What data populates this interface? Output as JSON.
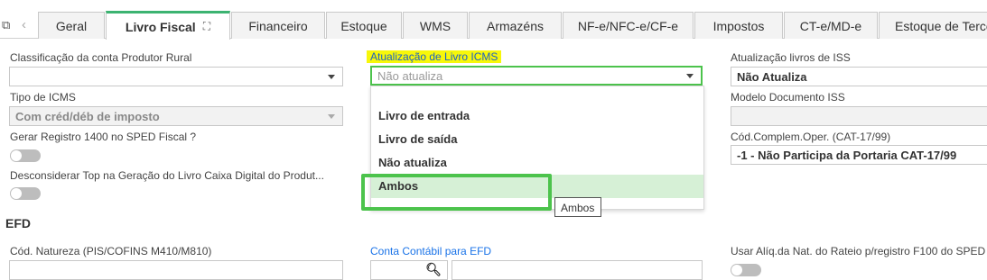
{
  "tabs": [
    {
      "label": "Geral"
    },
    {
      "label": "Livro Fiscal",
      "icon": "⛶"
    },
    {
      "label": "Financeiro"
    },
    {
      "label": "Estoque"
    },
    {
      "label": "WMS"
    },
    {
      "label": "Armazéns"
    },
    {
      "label": "NF-e/NFC-e/CF-e"
    },
    {
      "label": "Impostos"
    },
    {
      "label": "CT-e/MD-e"
    },
    {
      "label": "Estoque de Terce"
    }
  ],
  "left": {
    "classificacao_label": "Classificação da conta Produtor Rural",
    "classificacao_value": "",
    "tipo_icms_label": "Tipo de ICMS",
    "tipo_icms_value": "Com créd/déb de imposto",
    "registro1400_label": "Gerar Registro 1400 no SPED Fiscal ?",
    "desconsiderar_label": "Desconsiderar Top na Geração do Livro Caixa Digital do Produt..."
  },
  "middle": {
    "atualizacao_label": "Atualização de Livro ICMS",
    "atualizacao_placeholder": "Não atualiza",
    "options": [
      "Livro de entrada",
      "Livro de saída",
      "Não atualiza",
      "Ambos"
    ],
    "tooltip": "Ambos"
  },
  "right": {
    "iss_label": "Atualização livros de ISS",
    "iss_value": "Não Atualiza",
    "modelo_label": "Modelo Documento ISS",
    "modelo_value": "",
    "cod_label": "Cód.Complem.Oper. (CAT-17/99)",
    "cod_value": "-1 - Não Participa da Portaria CAT-17/99"
  },
  "efd": {
    "section_title": "EFD",
    "natureza_label": "Cód. Natureza (PIS/COFINS M410/M810)",
    "conta_label": "Conta Contábil para EFD",
    "aliq_label": "Usar Alíq.da Nat. do Rateio p/registro F100 do SPED"
  },
  "colors": {
    "accent": "#3cb371",
    "highlight": "#f7f70a",
    "link": "#1a73e8",
    "selection": "#d6f0d6"
  }
}
